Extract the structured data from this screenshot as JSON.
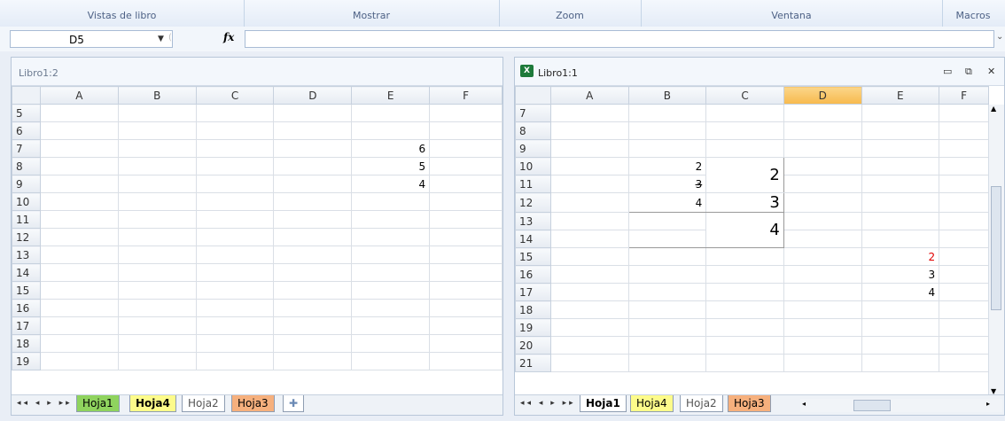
{
  "ribbon": {
    "groups": [
      "Vistas de libro",
      "Mostrar",
      "Zoom",
      "Ventana",
      "Macros"
    ]
  },
  "formula_bar": {
    "name_box": "D5",
    "fx": "fx",
    "formula": ""
  },
  "left_window": {
    "title": "Libro1:2",
    "columns": [
      "A",
      "B",
      "C",
      "D",
      "E",
      "F"
    ],
    "rows": [
      5,
      6,
      7,
      8,
      9,
      10,
      11,
      12,
      13,
      14,
      15,
      16,
      17,
      18,
      19
    ],
    "cells": {
      "E7": "6",
      "E8": "5",
      "E9": "4"
    },
    "tabs": [
      "Hoja1",
      "Hoja4",
      "Hoja2",
      "Hoja3"
    ],
    "active_tab": "Hoja4"
  },
  "right_window": {
    "title": "Libro1:1",
    "columns": [
      "A",
      "B",
      "C",
      "D",
      "E",
      "F"
    ],
    "selected_column": "D",
    "rows": [
      7,
      8,
      9,
      10,
      11,
      12,
      13,
      14,
      15,
      16,
      17,
      18,
      19,
      20,
      21
    ],
    "cells": {
      "B10": "2",
      "C10": "2",
      "B11": "3",
      "B12": "4",
      "C12": "3",
      "C13": "4",
      "E15": "2",
      "E16": "3",
      "E17": "4"
    },
    "tabs": [
      "Hoja1",
      "Hoja4",
      "Hoja2",
      "Hoja3"
    ],
    "active_tab": "Hoja1",
    "buttons": {
      "minimize": "▭",
      "restore": "⧉",
      "close": "✕"
    }
  },
  "colors": {
    "tab_green": "#8fd35e",
    "tab_yellow": "#fdfb8a",
    "tab_orange": "#f6b07d",
    "red_value": "#e00000",
    "selected_header": "#f7b94d"
  }
}
